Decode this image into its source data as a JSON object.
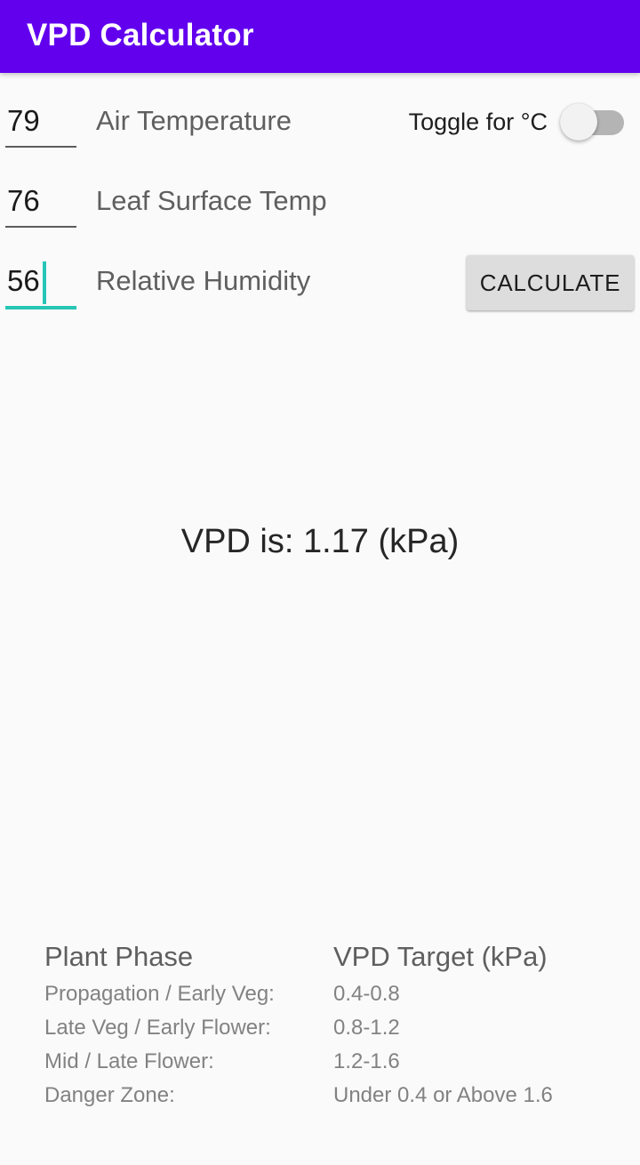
{
  "app": {
    "title": "VPD Calculator",
    "accent_purple": "#6200EE",
    "accent_teal": "#26C6B6",
    "background": "#FAFAFA"
  },
  "form": {
    "fields": [
      {
        "value": "79",
        "label": "Air Temperature",
        "focused": false
      },
      {
        "value": "76",
        "label": "Leaf Surface Temp",
        "focused": false
      },
      {
        "value": "56",
        "label": "Relative Humidity",
        "focused": true
      }
    ],
    "toggle": {
      "label": "Toggle for °C",
      "state": "off"
    },
    "calculate_label": "CALCULATE"
  },
  "result": {
    "text": "VPD is: 1.17 (kPa)",
    "value": "1.17",
    "unit": "kPa"
  },
  "reference": {
    "headers": {
      "phase": "Plant Phase",
      "target": "VPD Target (kPa)"
    },
    "rows": [
      {
        "phase": "Propagation / Early Veg:",
        "target": "0.4-0.8"
      },
      {
        "phase": "Late Veg / Early Flower:",
        "target": "0.8-1.2"
      },
      {
        "phase": "Mid / Late Flower:",
        "target": "1.2-1.6"
      },
      {
        "phase": "Danger Zone:",
        "target": "Under 0.4 or Above 1.6"
      }
    ]
  }
}
